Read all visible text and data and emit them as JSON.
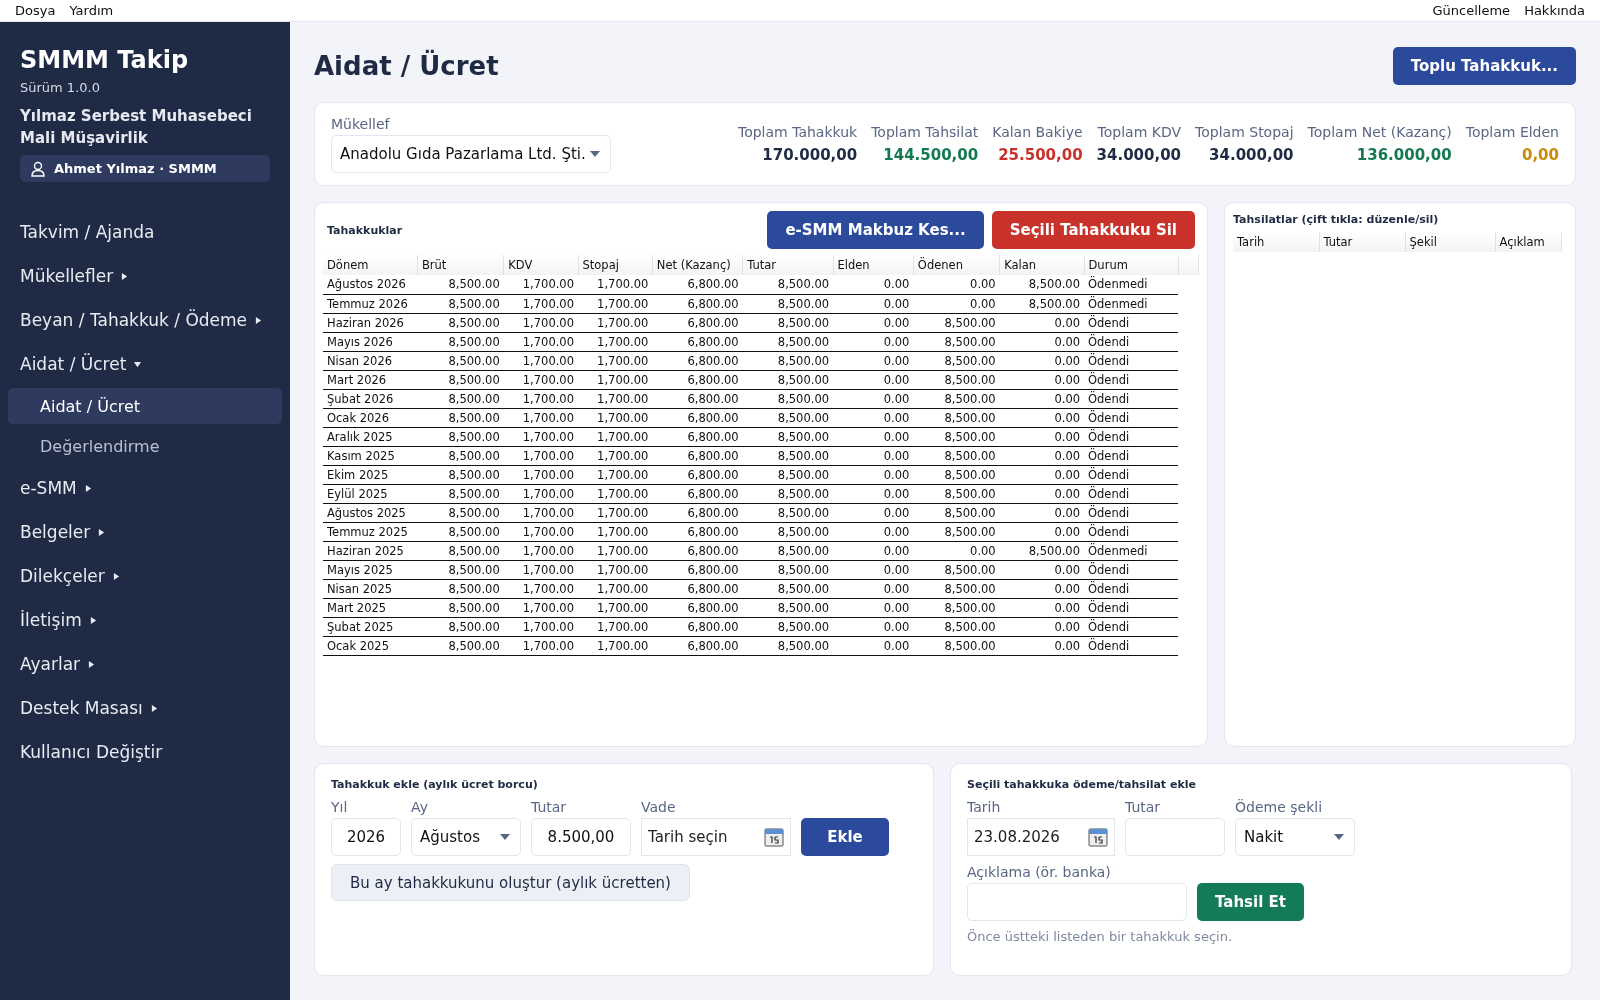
{
  "menu_bar": {
    "left": [
      "Dosya",
      "Yardım"
    ],
    "right": [
      "Güncelleme",
      "Hakkında"
    ]
  },
  "sidebar": {
    "app_title": "SMMM Takip",
    "version": "Sürüm 1.0.0",
    "company": "Yılmaz Serbest Muhasebeci Mali Müşavirlik",
    "user": "Ahmet Yılmaz · SMMM",
    "items": [
      {
        "label": "Takvim / Ajanda",
        "kind": "link"
      },
      {
        "label": "Mükellefler",
        "kind": "group",
        "expanded": false
      },
      {
        "label": "Beyan / Tahakkuk / Ödeme",
        "kind": "group",
        "expanded": false
      },
      {
        "label": "Aidat / Ücret",
        "kind": "group",
        "expanded": true,
        "children": [
          {
            "label": "Aidat / Ücret",
            "selected": true
          },
          {
            "label": "Değerlendirme",
            "selected": false
          }
        ]
      },
      {
        "label": "e-SMM",
        "kind": "group",
        "expanded": false
      },
      {
        "label": "Belgeler",
        "kind": "group",
        "expanded": false
      },
      {
        "label": "Dilekçeler",
        "kind": "group",
        "expanded": false
      },
      {
        "label": "İletişim",
        "kind": "group",
        "expanded": false
      },
      {
        "label": "Ayarlar",
        "kind": "group",
        "expanded": false
      },
      {
        "label": "Destek Masası",
        "kind": "group",
        "expanded": false
      },
      {
        "label": "Kullanıcı Değiştir",
        "kind": "link"
      }
    ]
  },
  "page_title": "Aidat / Ücret",
  "bulk_button": "Toplu Tahakkuk...",
  "taxpayer": {
    "label": "Mükellef",
    "value": "Anadolu Gıda Pazarlama Ltd. Şti."
  },
  "totals": [
    {
      "label": "Toplam Tahakkuk",
      "value": "170.000,00",
      "color": "#1f2a44"
    },
    {
      "label": "Toplam Tahsilat",
      "value": "144.500,00",
      "color": "#137a4f"
    },
    {
      "label": "Kalan Bakiye",
      "value": "25.500,00",
      "color": "#c8322b"
    },
    {
      "label": "Toplam KDV",
      "value": "34.000,00",
      "color": "#1f2a44"
    },
    {
      "label": "Toplam Stopaj",
      "value": "34.000,00",
      "color": "#1f2a44"
    },
    {
      "label": "Toplam Net (Kazanç)",
      "value": "136.000,00",
      "color": "#137a4f"
    },
    {
      "label": "Toplam Elden",
      "value": "0,00",
      "color": "#c98a0c"
    }
  ],
  "accruals": {
    "title": "Tahakkuklar",
    "buttons": [
      {
        "label": "e-SMM Makbuz Kes...",
        "kind": "primary"
      },
      {
        "label": "Seçili Tahakkuku Sil",
        "kind": "danger"
      }
    ],
    "columns": [
      "Dönem",
      "Brüt",
      "KDV",
      "Stopaj",
      "Net (Kazanç)",
      "Tutar",
      "Elden",
      "Ödenen",
      "Kalan",
      "Durum"
    ],
    "rows": [
      [
        "Ağustos 2026",
        "8,500.00",
        "1,700.00",
        "1,700.00",
        "6,800.00",
        "8,500.00",
        "0.00",
        "0.00",
        "8,500.00",
        "Ödenmedi"
      ],
      [
        "Temmuz 2026",
        "8,500.00",
        "1,700.00",
        "1,700.00",
        "6,800.00",
        "8,500.00",
        "0.00",
        "0.00",
        "8,500.00",
        "Ödenmedi"
      ],
      [
        "Haziran 2026",
        "8,500.00",
        "1,700.00",
        "1,700.00",
        "6,800.00",
        "8,500.00",
        "0.00",
        "8,500.00",
        "0.00",
        "Ödendi"
      ],
      [
        "Mayıs 2026",
        "8,500.00",
        "1,700.00",
        "1,700.00",
        "6,800.00",
        "8,500.00",
        "0.00",
        "8,500.00",
        "0.00",
        "Ödendi"
      ],
      [
        "Nisan 2026",
        "8,500.00",
        "1,700.00",
        "1,700.00",
        "6,800.00",
        "8,500.00",
        "0.00",
        "8,500.00",
        "0.00",
        "Ödendi"
      ],
      [
        "Mart 2026",
        "8,500.00",
        "1,700.00",
        "1,700.00",
        "6,800.00",
        "8,500.00",
        "0.00",
        "8,500.00",
        "0.00",
        "Ödendi"
      ],
      [
        "Şubat 2026",
        "8,500.00",
        "1,700.00",
        "1,700.00",
        "6,800.00",
        "8,500.00",
        "0.00",
        "8,500.00",
        "0.00",
        "Ödendi"
      ],
      [
        "Ocak 2026",
        "8,500.00",
        "1,700.00",
        "1,700.00",
        "6,800.00",
        "8,500.00",
        "0.00",
        "8,500.00",
        "0.00",
        "Ödendi"
      ],
      [
        "Aralık 2025",
        "8,500.00",
        "1,700.00",
        "1,700.00",
        "6,800.00",
        "8,500.00",
        "0.00",
        "8,500.00",
        "0.00",
        "Ödendi"
      ],
      [
        "Kasım 2025",
        "8,500.00",
        "1,700.00",
        "1,700.00",
        "6,800.00",
        "8,500.00",
        "0.00",
        "8,500.00",
        "0.00",
        "Ödendi"
      ],
      [
        "Ekim 2025",
        "8,500.00",
        "1,700.00",
        "1,700.00",
        "6,800.00",
        "8,500.00",
        "0.00",
        "8,500.00",
        "0.00",
        "Ödendi"
      ],
      [
        "Eylül 2025",
        "8,500.00",
        "1,700.00",
        "1,700.00",
        "6,800.00",
        "8,500.00",
        "0.00",
        "8,500.00",
        "0.00",
        "Ödendi"
      ],
      [
        "Ağustos 2025",
        "8,500.00",
        "1,700.00",
        "1,700.00",
        "6,800.00",
        "8,500.00",
        "0.00",
        "8,500.00",
        "0.00",
        "Ödendi"
      ],
      [
        "Temmuz 2025",
        "8,500.00",
        "1,700.00",
        "1,700.00",
        "6,800.00",
        "8,500.00",
        "0.00",
        "8,500.00",
        "0.00",
        "Ödendi"
      ],
      [
        "Haziran 2025",
        "8,500.00",
        "1,700.00",
        "1,700.00",
        "6,800.00",
        "8,500.00",
        "0.00",
        "0.00",
        "8,500.00",
        "Ödenmedi"
      ],
      [
        "Mayıs 2025",
        "8,500.00",
        "1,700.00",
        "1,700.00",
        "6,800.00",
        "8,500.00",
        "0.00",
        "8,500.00",
        "0.00",
        "Ödendi"
      ],
      [
        "Nisan 2025",
        "8,500.00",
        "1,700.00",
        "1,700.00",
        "6,800.00",
        "8,500.00",
        "0.00",
        "8,500.00",
        "0.00",
        "Ödendi"
      ],
      [
        "Mart 2025",
        "8,500.00",
        "1,700.00",
        "1,700.00",
        "6,800.00",
        "8,500.00",
        "0.00",
        "8,500.00",
        "0.00",
        "Ödendi"
      ],
      [
        "Şubat 2025",
        "8,500.00",
        "1,700.00",
        "1,700.00",
        "6,800.00",
        "8,500.00",
        "0.00",
        "8,500.00",
        "0.00",
        "Ödendi"
      ],
      [
        "Ocak 2025",
        "8,500.00",
        "1,700.00",
        "1,700.00",
        "6,800.00",
        "8,500.00",
        "0.00",
        "8,500.00",
        "0.00",
        "Ödendi"
      ]
    ]
  },
  "collections": {
    "title": "Tahsilatlar (çift tıkla: düzenle/sil)",
    "columns": [
      "Tarih",
      "Tutar",
      "Şekil",
      "Açıklam"
    ]
  },
  "add_accrual": {
    "title": "Tahakkuk ekle (aylık ücret borcu)",
    "year_label": "Yıl",
    "year": "2026",
    "month_label": "Ay",
    "month": "Ağustos",
    "amount_label": "Tutar",
    "amount": "8.500,00",
    "due_label": "Vade",
    "due_placeholder": "Tarih seçin",
    "add_button": "Ekle",
    "generate_button": "Bu ay tahakkukunu oluştur (aylık ücretten)"
  },
  "add_payment": {
    "title": "Seçili tahakkuka ödeme/tahsilat ekle",
    "date_label": "Tarih",
    "date": "23.08.2026",
    "amount_label": "Tutar",
    "method_label": "Ödeme şekli",
    "method": "Nakit",
    "note_label": "Açıklama (ör. banka)",
    "collect_button": "Tahsil Et",
    "hint": "Önce üstteki listeden bir tahakkuk seçin."
  }
}
